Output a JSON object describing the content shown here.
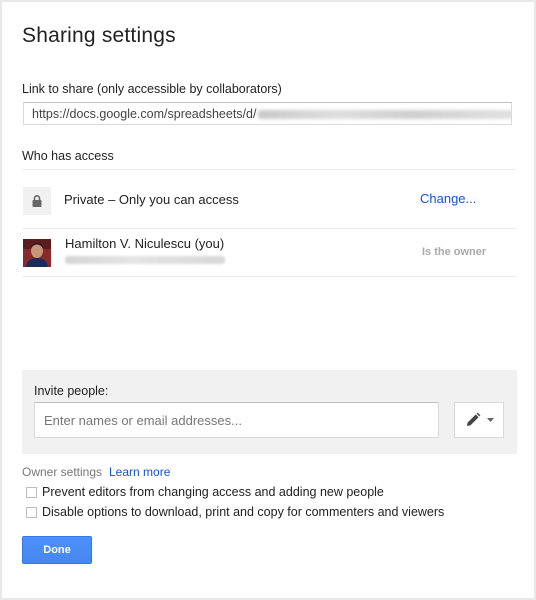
{
  "dialog": {
    "title": "Sharing settings",
    "link_label": "Link to share (only accessible by collaborators)",
    "link_value": "https://docs.google.com/spreadsheets/d/",
    "who_has_access": "Who has access",
    "access": {
      "icon": "lock-icon",
      "text": "Private – Only you can access",
      "change_link": "Change..."
    },
    "owner": {
      "name": "Hamilton V. Niculescu (you)",
      "role": "Is the owner"
    },
    "invite": {
      "label": "Invite people:",
      "placeholder": "Enter names or email addresses...",
      "permission_icon": "pencil-icon"
    },
    "owner_settings": {
      "label": "Owner settings",
      "learn_more": "Learn more",
      "options": [
        {
          "label": "Prevent editors from changing access and adding new people",
          "checked": false
        },
        {
          "label": "Disable options to download, print and copy for commenters and viewers",
          "checked": false
        }
      ]
    },
    "done_label": "Done"
  },
  "colors": {
    "link": "#1155cc",
    "primary_button": "#4d90fe",
    "panel_bg": "#f1f1f1"
  }
}
